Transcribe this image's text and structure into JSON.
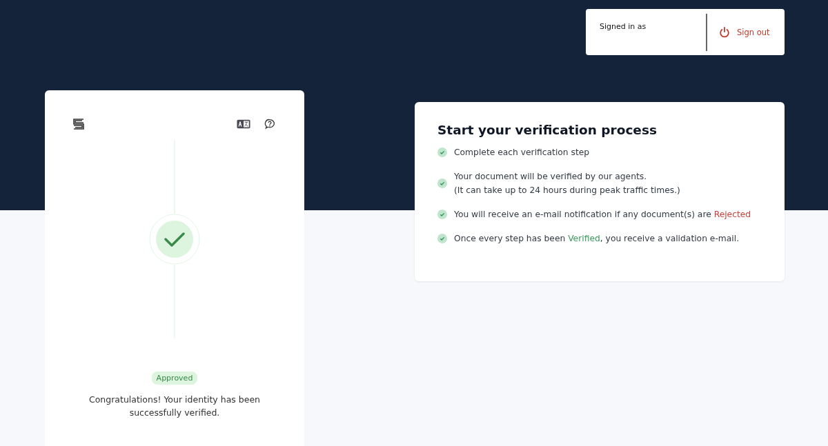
{
  "account_box": {
    "label": "Signed in as",
    "sign_out": "Sign out"
  },
  "status_card": {
    "status": "Approved",
    "message": "Congratulations! Your identity has been successfully verified."
  },
  "info_card": {
    "title": "Start your verification process",
    "items": [
      {
        "lines": [
          [
            {
              "text": "Complete each verification step"
            }
          ]
        ]
      },
      {
        "lines": [
          [
            {
              "text": "Your document will be verified by our agents."
            }
          ],
          [
            {
              "text": "(It can take up to 24 hours during peak traffic times.)"
            }
          ]
        ]
      },
      {
        "lines": [
          [
            {
              "text": "You will receive an e-mail notification if any document(s) are "
            },
            {
              "text": "Rejected",
              "color": "#c6423a"
            }
          ]
        ]
      },
      {
        "lines": [
          [
            {
              "text": "Once every step has been "
            },
            {
              "text": "Verified",
              "color": "#3a9a5b"
            },
            {
              "text": ", you receive a validation e-mail."
            }
          ]
        ]
      }
    ]
  }
}
